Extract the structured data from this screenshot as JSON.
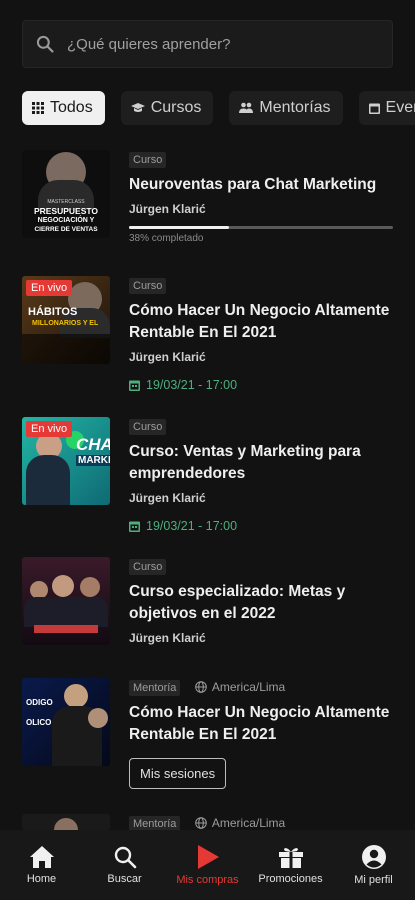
{
  "search": {
    "placeholder": "¿Qué quieres aprender?"
  },
  "filters": [
    "Todos",
    "Cursos",
    "Mentorías",
    "Eventos"
  ],
  "items": [
    {
      "tag": "Curso",
      "title": "Neuroventas para Chat Marketing",
      "author": "Jürgen Klarić",
      "progress_text": "38% completado",
      "progress": 0.38,
      "thumb_text": [
        "MASTERCLASS",
        "PRESUPUESTO",
        "NEGOCIACIÓN Y",
        "CIERRE DE VENTAS"
      ]
    },
    {
      "tag": "Curso",
      "title": "Cómo Hacer Un Negocio Altamente Rentable En El 2021",
      "author": "Jürgen Klarić",
      "date": "19/03/21 - 17:00",
      "live": "En vivo",
      "thumb_text": [
        "HÁBITOS",
        "MILLONARIOS Y EL"
      ]
    },
    {
      "tag": "Curso",
      "title": "Curso: Ventas y Marketing para emprendedores",
      "author": "Jürgen Klarić",
      "date": "19/03/21 - 17:00",
      "live": "En vivo",
      "thumb_text": [
        "CHA",
        "MARKE"
      ]
    },
    {
      "tag": "Curso",
      "title": "Curso especializado: Metas y objetivos en el 2022",
      "author": "Jürgen Klarić"
    },
    {
      "tag": "Mentoría",
      "timezone": "America/Lima",
      "title": "Cómo Hacer Un Negocio Altamente Rentable En El 2021",
      "button": "Mis sesiones",
      "thumb_text": [
        "ODIGO",
        "OLICO"
      ]
    },
    {
      "tag": "Mentoría",
      "timezone": "America/Lima"
    }
  ],
  "nav": [
    {
      "label": "Home",
      "icon": "home-icon"
    },
    {
      "label": "Buscar",
      "icon": "search-icon"
    },
    {
      "label": "Mis compras",
      "icon": "play-icon",
      "active": true
    },
    {
      "label": "Promociones",
      "icon": "gift-icon"
    },
    {
      "label": "Mi perfil",
      "icon": "profile-icon"
    }
  ],
  "colors": {
    "background": "#121212",
    "accent": "#e53935",
    "date": "#4caf7d"
  }
}
